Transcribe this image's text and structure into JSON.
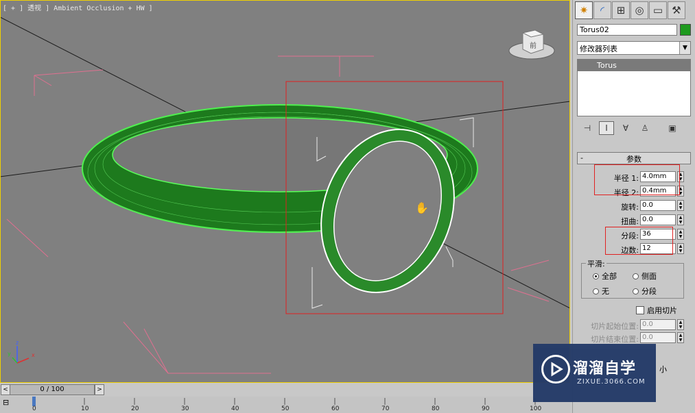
{
  "viewport": {
    "label": "[ + ] 透视 ] Ambient Occlusion + HW ]",
    "axis_x": "x",
    "axis_y": "y",
    "axis_z": "z",
    "viewcube_face": "前"
  },
  "command_panel": {
    "tabs": [
      {
        "icon": "create-icon",
        "glyph": "✷"
      },
      {
        "icon": "modify-icon",
        "glyph": "◜"
      },
      {
        "icon": "hierarchy-icon",
        "glyph": "⊞"
      },
      {
        "icon": "motion-icon",
        "glyph": "◎"
      },
      {
        "icon": "display-icon",
        "glyph": "▭"
      },
      {
        "icon": "utilities-icon",
        "glyph": "⚒"
      }
    ],
    "object_name": "Torus02",
    "object_color": "#1e9a1e",
    "modifier_list": "修改器列表",
    "stack_items": [
      "Torus"
    ],
    "rollout_title": "参数",
    "rollout_toggle": "-",
    "params": [
      {
        "label": "半径 1:",
        "value": "4.0mm"
      },
      {
        "label": "半径 2:",
        "value": "0.4mm"
      },
      {
        "label": "旋转:",
        "value": "0.0"
      },
      {
        "label": "扭曲:",
        "value": "0.0"
      },
      {
        "label": "分段:",
        "value": "36"
      },
      {
        "label": "边数:",
        "value": "12"
      }
    ],
    "smoothing": {
      "title": "平滑:",
      "options": [
        "全部",
        "侧面",
        "无",
        "分段"
      ],
      "selected": "全部"
    },
    "slice_on": "启用切片",
    "slice_from": {
      "label": "切片起始位置:",
      "value": "0.0"
    },
    "slice_to": {
      "label": "切片结束位置:",
      "value": "0.0"
    },
    "partial_label": "小"
  },
  "timeline": {
    "frame_display": "0 / 100",
    "prev": "<",
    "next": ">",
    "ticks": [
      "0",
      "10",
      "20",
      "30",
      "40",
      "50",
      "60",
      "70",
      "80",
      "90",
      "100"
    ]
  },
  "watermark": {
    "title": "溜溜自学",
    "subtitle": "ZIXUE.3066.COM"
  }
}
